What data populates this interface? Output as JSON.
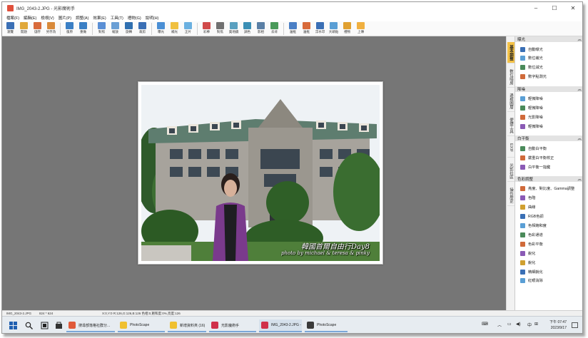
{
  "window": {
    "title": "IMG_2043-2.JPG - 光影魔術手",
    "controls": {
      "minimize": "–",
      "maximize": "☐",
      "close": "✕"
    }
  },
  "menu": [
    "檔案(F)",
    "編輯(E)",
    "檢視(V)",
    "圖片(P)",
    "調整(A)",
    "效果(E)",
    "工具(T)",
    "禮物(G)",
    "說明(H)"
  ],
  "toolbar": [
    {
      "label": "瀏覽",
      "icon": "browse-icon",
      "color": "#3a6fb5"
    },
    {
      "label": "開啟",
      "icon": "open-icon",
      "color": "#e0a83a"
    },
    {
      "label": "儲存",
      "icon": "save-icon",
      "color": "#d96a3a"
    },
    {
      "label": "另存為",
      "icon": "save-as-icon",
      "color": "#d98a3a"
    },
    {
      "label": "復原",
      "icon": "undo-icon",
      "color": "#3a7fc5"
    },
    {
      "label": "重做",
      "icon": "redo-icon",
      "color": "#3a7fc5"
    },
    {
      "label": "對照",
      "icon": "compare-icon",
      "color": "#5a8fd5"
    },
    {
      "label": "縮放",
      "icon": "zoom-icon",
      "color": "#6a9fd5"
    },
    {
      "label": "旋轉",
      "icon": "rotate-icon",
      "color": "#2f6fb0"
    },
    {
      "label": "裁剪",
      "icon": "crop-icon",
      "color": "#3a6fb5"
    },
    {
      "label": "曝光",
      "icon": "exposure-icon",
      "color": "#4a8fd5"
    },
    {
      "label": "補光",
      "icon": "fill-light-icon",
      "color": "#f0c040"
    },
    {
      "label": "正片",
      "icon": "positive-film-icon",
      "color": "#6ab0e0"
    },
    {
      "label": "彩棒",
      "icon": "color-wand-icon",
      "color": "#d04a4a"
    },
    {
      "label": "對焦",
      "icon": "focus-icon",
      "color": "#707070"
    },
    {
      "label": "奧地鏡",
      "icon": "lens-icon",
      "color": "#5aa0c0"
    },
    {
      "label": "調色",
      "icon": "palette-icon",
      "color": "#3a8fb5"
    },
    {
      "label": "影相",
      "icon": "portrait-icon",
      "color": "#5a7fa5"
    },
    {
      "label": "去背",
      "icon": "cutout-icon",
      "color": "#4a9a5a"
    },
    {
      "label": "邊框",
      "icon": "border-icon",
      "color": "#4a7fc5"
    },
    {
      "label": "邊框",
      "icon": "frame-icon",
      "color": "#d86a3a"
    },
    {
      "label": "浮水印",
      "icon": "watermark-icon",
      "color": "#3a6fb5"
    },
    {
      "label": "大頭貼",
      "icon": "sticker-icon",
      "color": "#5a9fd5"
    },
    {
      "label": "禮物",
      "icon": "gift-icon",
      "color": "#e0a030"
    },
    {
      "label": "上傳",
      "icon": "upload-icon",
      "color": "#f0b040"
    }
  ],
  "vertical_tabs": [
    "基本調整",
    "數位暗房",
    "邊框圖層",
    "便捷工具",
    "EXIF",
    "光影社區",
    "操作歷史"
  ],
  "panel": {
    "sections": [
      {
        "title": "曝光",
        "items": [
          "自動曝光",
          "數位補光",
          "數位減光",
          "數字點測光"
        ]
      },
      {
        "title": "降噪",
        "items": [
          "輕微降噪",
          "輕微降噪",
          "光影降噪",
          "輕微降噪"
        ]
      },
      {
        "title": "白平衡",
        "items": [
          "自動白平衡",
          "嚴重白平衡校正",
          "白平衡一指鍵"
        ]
      },
      {
        "title": "色彩調整",
        "items": [
          "亮度、對比度、Gamma調整",
          "色階",
          "曲線",
          "RGB色調",
          "色相飽和度",
          "色彩通道",
          "色彩平衡",
          "銳化",
          "銳化",
          "精細銳化",
          "紅眼消除"
        ]
      }
    ],
    "collapse_glyph": "︽"
  },
  "photo": {
    "caption_line1": "韓國首爾自由行Day8",
    "caption_line2": "photo by michael & teresa & pinky"
  },
  "status": {
    "filename": "IMG_2043-2.JPG",
    "dimensions": "824 * 624",
    "pixel_info": "X:0,Y:0 R:126,G:126,B:126 色相:0,飽和度:0%,亮度:126"
  },
  "taskbar": {
    "windows": [
      {
        "label": "搜尋部落格社群分...",
        "color": "#e05a3a"
      },
      {
        "label": "PhotoScape",
        "color": "#f0c030"
      },
      {
        "label": "新增資料夾 (16)",
        "color": "#f0c030"
      },
      {
        "label": "光影魔術手",
        "color": "#d0304a"
      },
      {
        "label": "IMG_2043-2.JPG - ...",
        "color": "#d0304a",
        "active": true
      },
      {
        "label": "PhotoScape",
        "color": "#3a3a3a"
      }
    ],
    "tray": {
      "lang": "中",
      "caret": "︿"
    },
    "clock": {
      "time": "下午 07:47",
      "date": "2023/9/17"
    }
  }
}
